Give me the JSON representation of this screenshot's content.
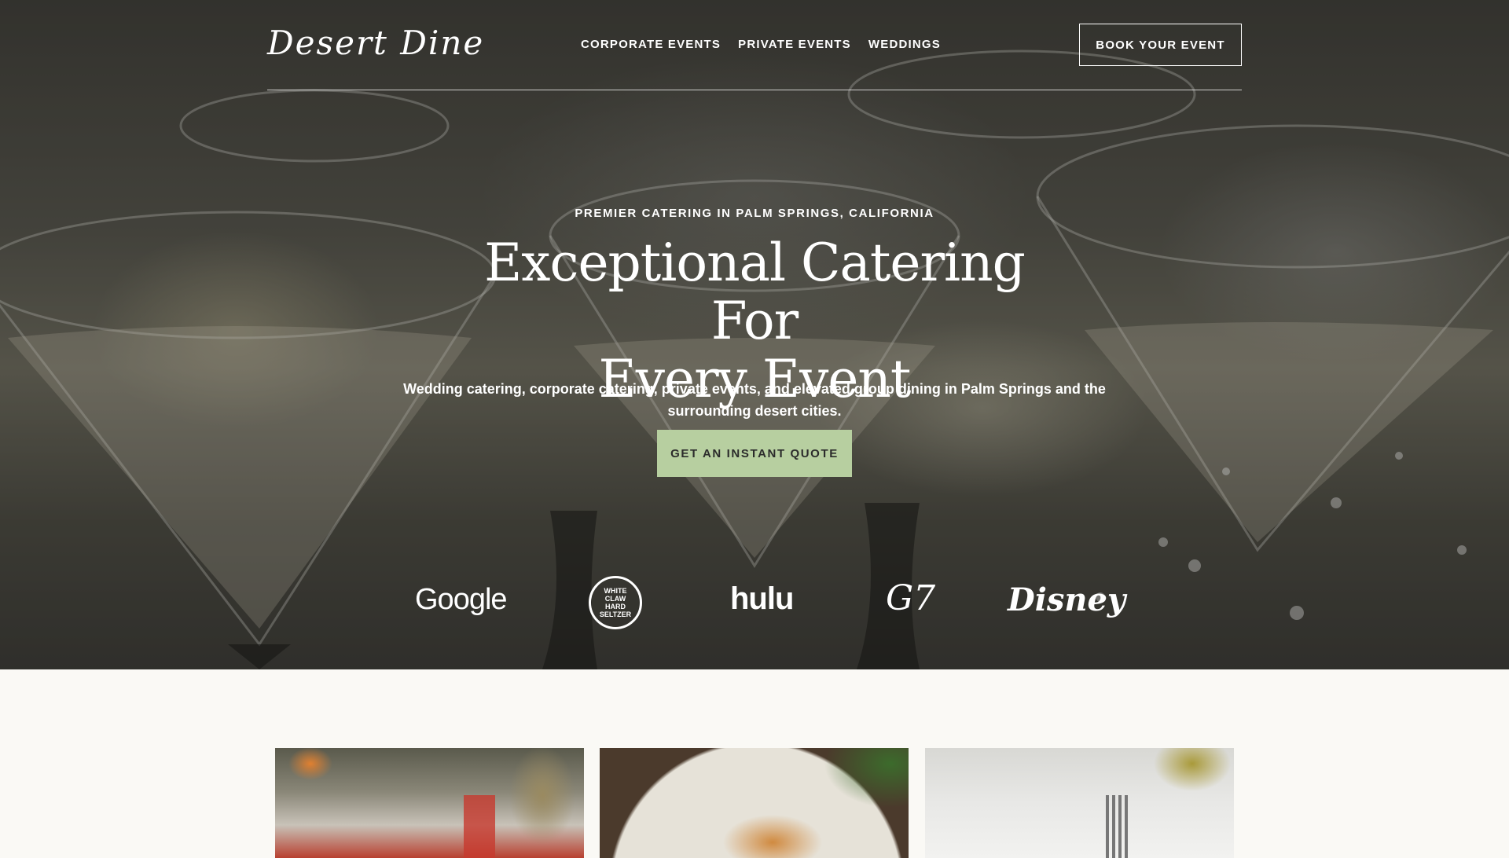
{
  "brand": {
    "logo_text": "Desert Dine"
  },
  "nav": {
    "links": [
      "CORPORATE EVENTS",
      "PRIVATE EVENTS",
      "WEDDINGS"
    ],
    "cta": "BOOK YOUR EVENT"
  },
  "hero": {
    "eyebrow": "PREMIER CATERING IN PALM SPRINGS, CALIFORNIA",
    "headline_line1": "Exceptional Catering For",
    "headline_line2": "Every Event",
    "subtext": "Wedding catering, corporate catering, private events, and elevated group dining in Palm Springs and the surrounding desert cities.",
    "cta": "GET AN INSTANT QUOTE"
  },
  "client_logos": {
    "google": "Google",
    "whiteclaw": "WHITE CLAW HARD SELTZER",
    "hulu": "hulu",
    "g7": "G7",
    "disney": "Disney"
  },
  "colors": {
    "accent_button": "#b7cfa0",
    "page_background": "#faf9f5"
  }
}
